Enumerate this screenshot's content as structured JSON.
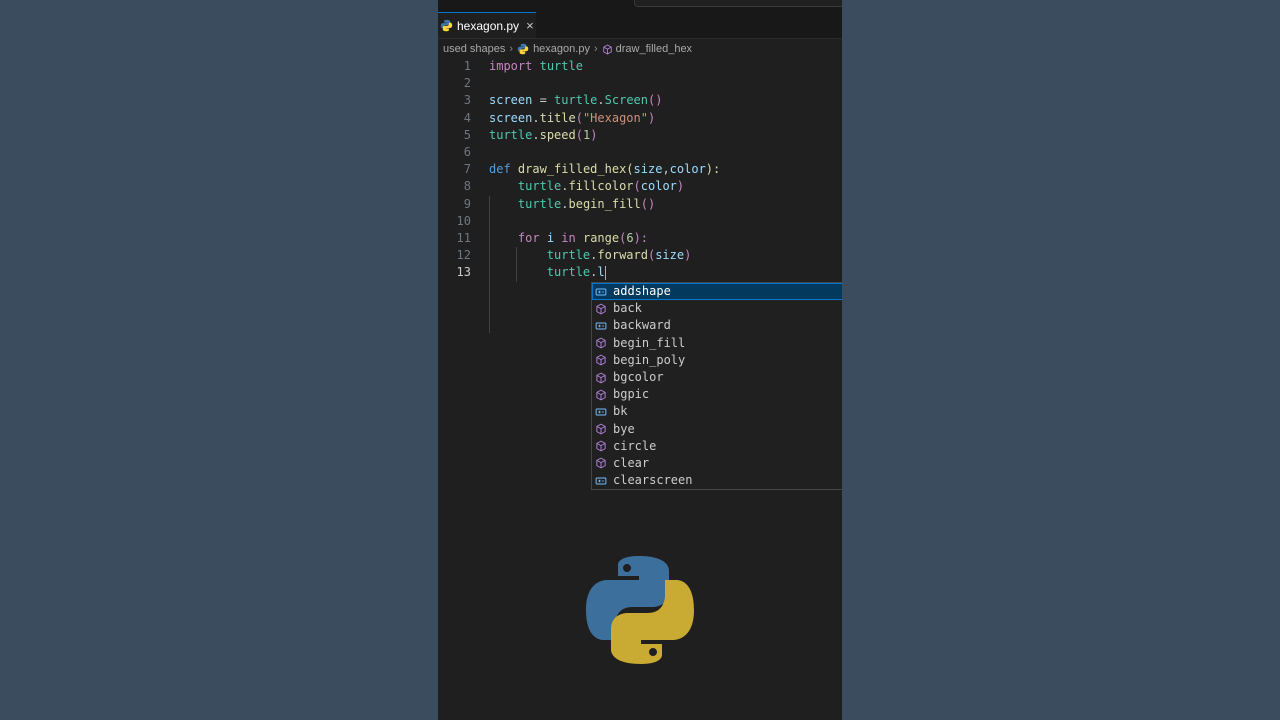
{
  "tab": {
    "label": "hexagon.py",
    "close": "×"
  },
  "breadcrumb": {
    "folder": "used shapes",
    "file": "hexagon.py",
    "symbol": "draw_filled_hex"
  },
  "code": {
    "line_numbers": [
      "1",
      "2",
      "3",
      "4",
      "5",
      "6",
      "7",
      "8",
      "9",
      "10",
      "11",
      "12",
      "13"
    ],
    "l1": {
      "kw": "import",
      "mod": "turtle"
    },
    "l3": {
      "a": "screen",
      "b": " = ",
      "c": "turtle",
      "d": ".",
      "e": "Screen",
      "f": "()"
    },
    "l4": {
      "a": "screen",
      "b": ".",
      "c": "title",
      "d": "(",
      "e": "\"Hexagon\"",
      "f": ")"
    },
    "l5": {
      "a": "turtle",
      "b": ".",
      "c": "speed",
      "d": "(",
      "e": "1",
      "f": ")"
    },
    "l7": {
      "a": "def",
      "b": " ",
      "c": "draw_filled_hex",
      "d": "(",
      "e": "size",
      "f": ",",
      "g": "color",
      "h": "):"
    },
    "l8": {
      "a": "turtle",
      "b": ".",
      "c": "fillcolor",
      "d": "(",
      "e": "color",
      "f": ")"
    },
    "l9": {
      "a": "turtle",
      "b": ".",
      "c": "begin_fill",
      "d": "()"
    },
    "l11": {
      "a": "for",
      "b": " ",
      "c": "i",
      "d": " ",
      "e": "in",
      "f": " ",
      "g": "range",
      "h": "(",
      "i": "6",
      "j": "):"
    },
    "l12": {
      "a": "turtle",
      "b": ".",
      "c": "forward",
      "d": "(",
      "e": "size",
      "f": ")"
    },
    "l13": {
      "a": "turtle",
      "b": ".",
      "c": "l"
    }
  },
  "suggestions": [
    {
      "label": "addshape",
      "kind": "variable"
    },
    {
      "label": "back",
      "kind": "method"
    },
    {
      "label": "backward",
      "kind": "variable"
    },
    {
      "label": "begin_fill",
      "kind": "method"
    },
    {
      "label": "begin_poly",
      "kind": "method"
    },
    {
      "label": "bgcolor",
      "kind": "method"
    },
    {
      "label": "bgpic",
      "kind": "method"
    },
    {
      "label": "bk",
      "kind": "variable"
    },
    {
      "label": "bye",
      "kind": "method"
    },
    {
      "label": "circle",
      "kind": "method"
    },
    {
      "label": "clear",
      "kind": "method"
    },
    {
      "label": "clearscreen",
      "kind": "variable"
    }
  ],
  "colors": {
    "accent": "#0078d4",
    "selected_bg": "#04395e",
    "python_blue": "#3c6e9e",
    "python_yellow": "#ffd43b"
  },
  "icons": {
    "tab": "python-icon",
    "symbol": "cube-icon",
    "variable": "variable-icon",
    "method": "method-cube-icon"
  }
}
